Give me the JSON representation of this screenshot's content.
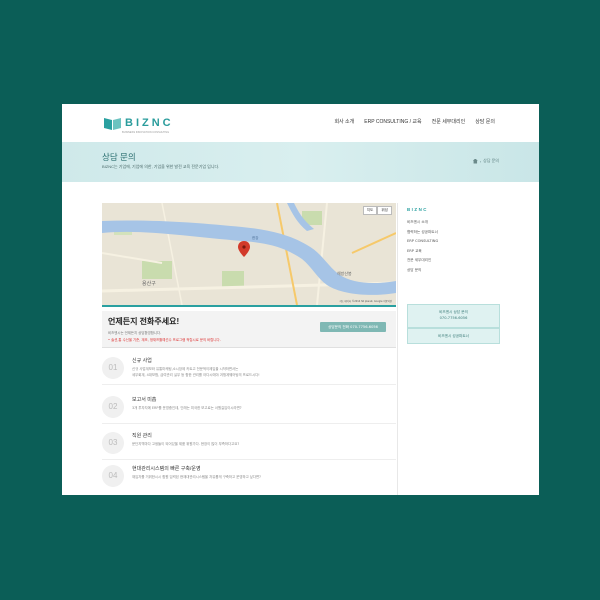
{
  "header": {
    "logo_text": "BIZNC",
    "logo_sub": "BUSINESS INNOVATION CONSULTING",
    "nav": [
      "회사 소개",
      "ERP CONSULTING / 교육",
      "전문 세무대리인",
      "상담 문의"
    ]
  },
  "banner": {
    "title": "상담 문의",
    "desc": "BIZNC는 기업에, 기업에 의한, 기업을 위한 발전 교육 전문기업 입니다.",
    "crumb": "상담 문의"
  },
  "map": {
    "btn_map": "지도",
    "btn_sat": "위성",
    "label_main": "한강",
    "label_west": "용산구",
    "label_east": "해방산봉",
    "credit": "지도 데이터 ©2014 SK planet, Google  이용약관"
  },
  "call": {
    "title": "언제든지 전화주세요!",
    "line1": "비즈엔시는 언제든지 상담환영합니다.",
    "line2": "• 솔션,통 수신을 기준, 계조, 정재프틀예선수 프로그램 적립시로 문의 바랍니다.",
    "button": "상담문의 전화 070-7756-6056"
  },
  "services": [
    {
      "num": "01",
      "title": "신규 사업",
      "desc": "신규 사업계보와 유통마케팅,소시장제 카트고 전문적이제입을 시작하면서는\n세무회계, 4대보험, 급여관리 실무 등 함한 관리를 아다시에야 겨쟁계웨어팅의 프로드시다!"
    },
    {
      "num": "02",
      "title": "보고서 미흡",
      "desc": "3개 투자자에 ERP를 운영중인데, 인래는 미국한 보고로는 서원길입이시라면?"
    },
    {
      "num": "03",
      "title": "직원 관리",
      "desc": "문단지역마다 고생들이 되어있을 제품 위원가다. 현장이 많이 부족하다고요?"
    },
    {
      "num": "04",
      "title": "현대관리시스템의 빠른 구축/운영",
      "desc": "재입자를 거위한시시 합원 입력된 현재대관리시스템을 자유롭게 구축하고 운영하고 싶다면?"
    }
  ],
  "sidebar": {
    "heading": "BIZNC",
    "menu": [
      "비즈엔시 소개",
      "협력하는 성공파트너",
      "ERP CONSULTING",
      "ERP 교육",
      "전문 세무대리인",
      "상담 문의"
    ],
    "box1_line1": "비즈엔시 상담 문의",
    "box1_line2": "070-7756-6056",
    "box2": "비즈엔시 성공파트너"
  }
}
